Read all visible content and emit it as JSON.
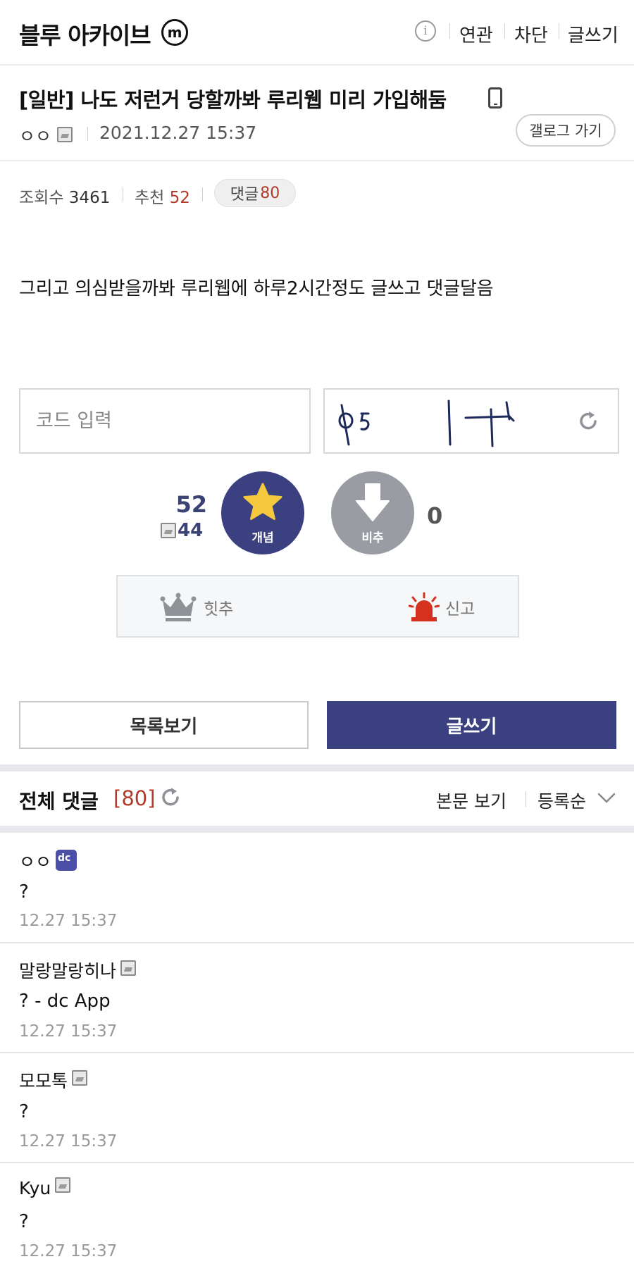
{
  "header": {
    "gallery_name": "블루 아카이브",
    "minor_badge": "m",
    "info_icon": "i",
    "nav": [
      "연관",
      "차단",
      "글쓰기"
    ]
  },
  "post": {
    "title": "[일반] 나도 저런거 당할까봐 루리웹 미리 가입해둠",
    "author": "ㅇㅇ",
    "date": "2021.12.27 15:37",
    "gallog_button": "갤로그 가기",
    "views_label": "조회수",
    "views": "3461",
    "recommend_label": "추천",
    "recommend": "52",
    "comments_label": "댓글",
    "comments": "80",
    "body": "그리고 의심받을까봐 루리웹에 하루2시간정도 글쓰고 댓글달음"
  },
  "captcha": {
    "placeholder": "코드 입력"
  },
  "votes": {
    "up": "52",
    "fix": "44",
    "up_label": "개념",
    "down_label": "비추",
    "down": "0",
    "hit_label": "힛추",
    "report_label": "신고"
  },
  "actions": {
    "list_label": "목록보기",
    "write_label": "글쓰기"
  },
  "comments_section": {
    "title": "전체 댓글",
    "count": "[80]",
    "view_body": "본문 보기",
    "sort": "등록순"
  },
  "comments": [
    {
      "name": "ㅇㅇ",
      "text": "?",
      "time": "12.27 15:37"
    },
    {
      "name": "말랑말랑히나",
      "text": "? - dc App",
      "time": "12.27 15:37"
    },
    {
      "name": "모모톡",
      "text": "?",
      "time": "12.27 15:37"
    },
    {
      "name": "Kyu",
      "text": "?",
      "time": "12.27 15:37"
    }
  ],
  "colors": {
    "accent": "#3b4180",
    "red": "#b23a2a",
    "downvote": "#9a9ca3"
  }
}
